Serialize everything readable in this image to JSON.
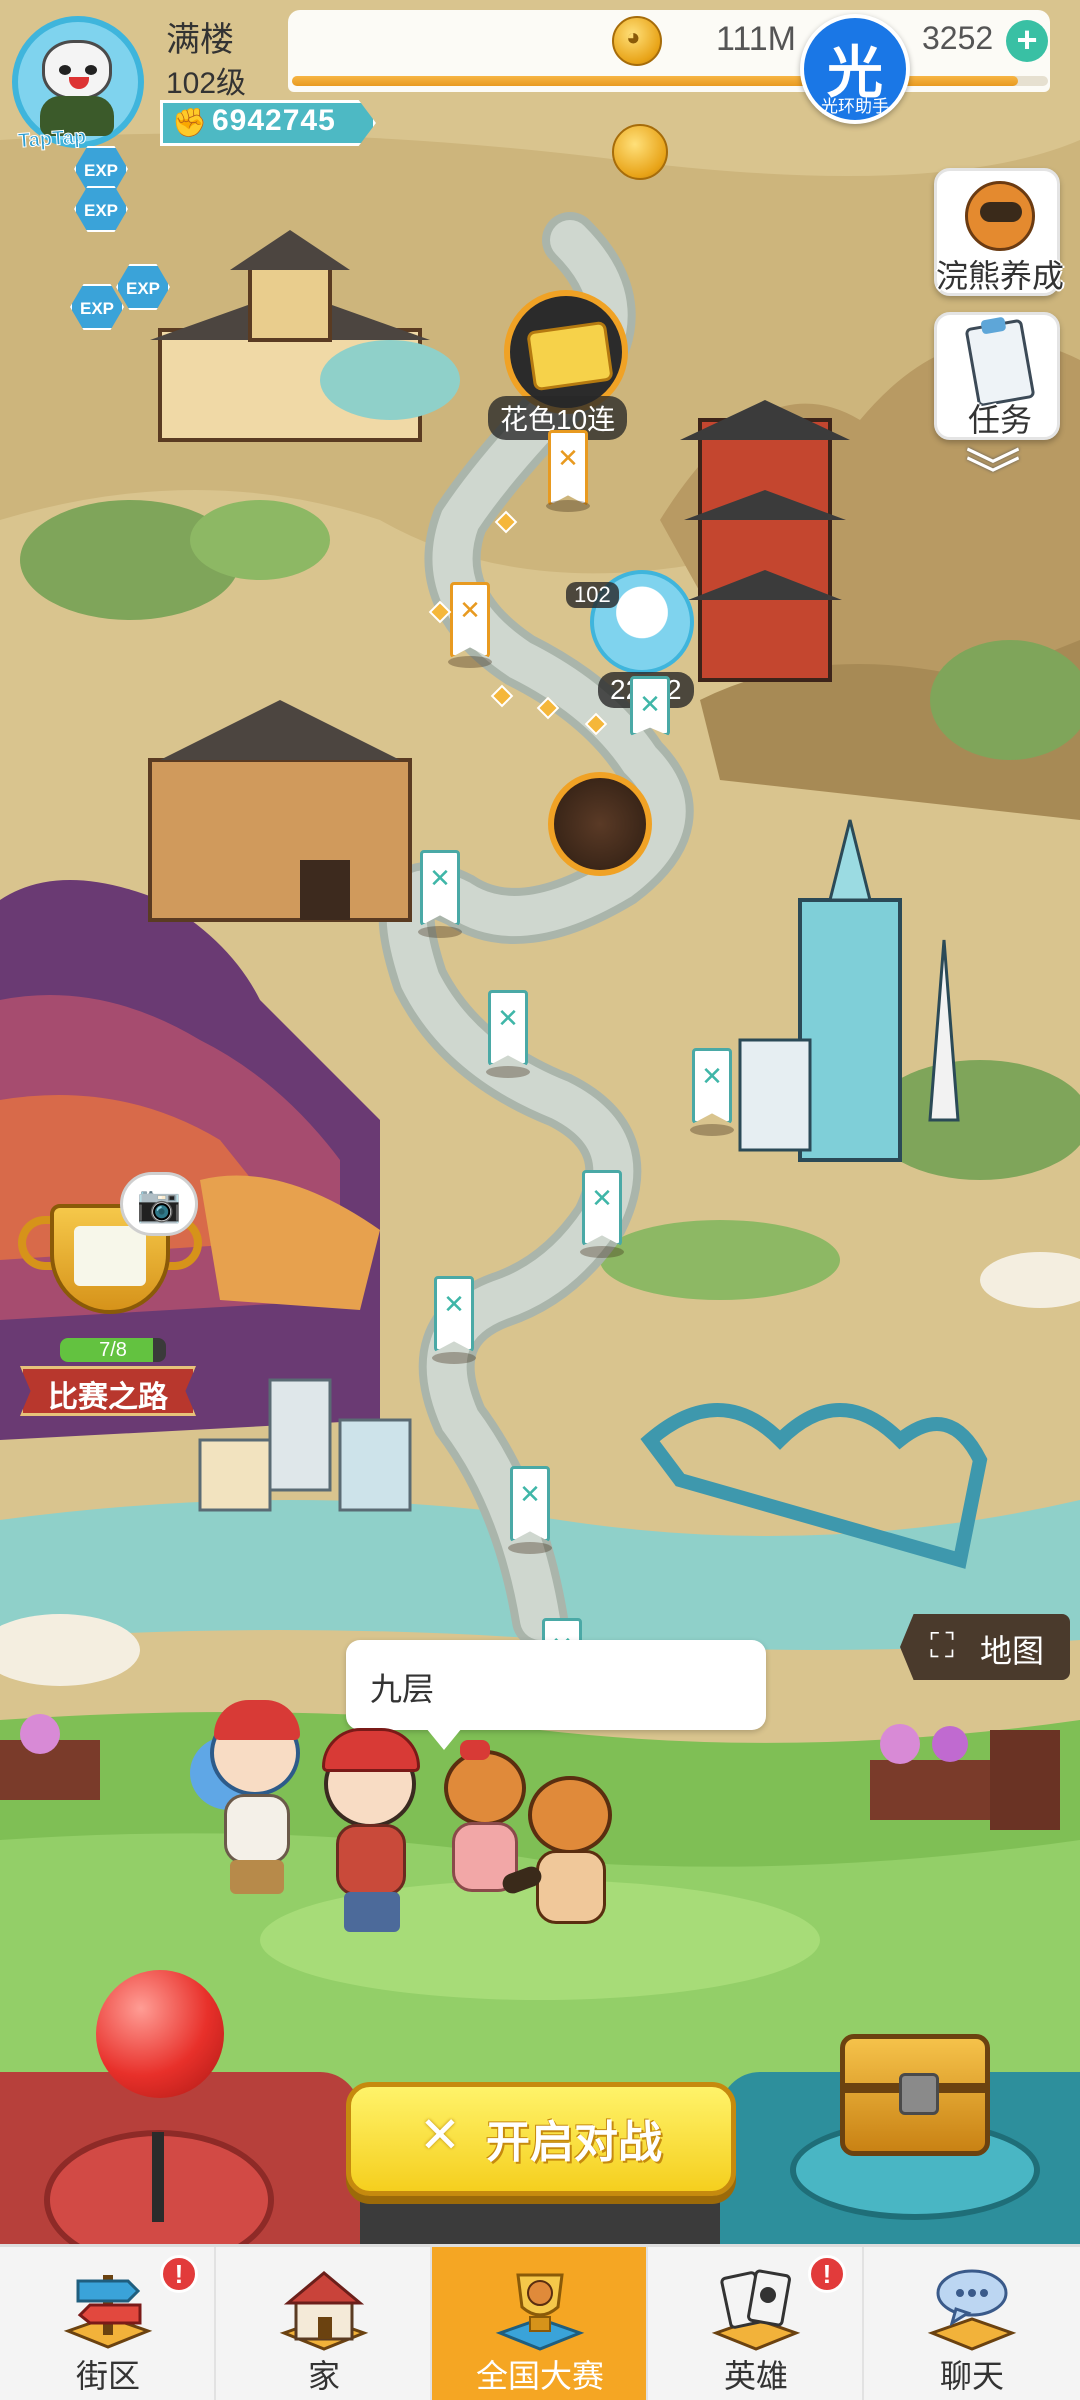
{
  "player": {
    "name": "满楼",
    "level": "102级",
    "power": "6942745",
    "avatar_brand": "TapTap",
    "xp_fraction": 0.96
  },
  "resources": {
    "coins": "111M",
    "gems": "3252",
    "plus_icon": "plus-icon",
    "halo_badge_big": "光",
    "halo_badge_small": "光环助手"
  },
  "exp_badges": [
    "EXP",
    "EXP",
    "EXP",
    "EXP"
  ],
  "side_buttons": {
    "raccoon_label": "浣熊养成",
    "task_label": "任务"
  },
  "map_nodes": {
    "reward_label": "花色10连",
    "player_level": "102",
    "stage_label": "22-52"
  },
  "trophy": {
    "progress_text": "7/8",
    "progress_fraction": 0.875,
    "banner": "比赛之路"
  },
  "map_button": {
    "label": "地图"
  },
  "speech": {
    "text": "九层"
  },
  "start_button": {
    "label": "开启对战"
  },
  "nav": {
    "items": [
      {
        "label": "街区",
        "icon": "signpost-icon",
        "badge": "!"
      },
      {
        "label": "家",
        "icon": "house-icon",
        "badge": ""
      },
      {
        "label": "全国大赛",
        "icon": "trophy-icon",
        "badge": "",
        "active": true
      },
      {
        "label": "英雄",
        "icon": "cards-icon",
        "badge": "!"
      },
      {
        "label": "聊天",
        "icon": "chat-bubble-icon",
        "badge": ""
      }
    ]
  },
  "colors": {
    "accent_orange": "#f5a623",
    "start_yellow": "#f5cf1e",
    "badge_red": "#e23b3b",
    "teal": "#2d8f9c",
    "console_red": "#b7403b"
  }
}
